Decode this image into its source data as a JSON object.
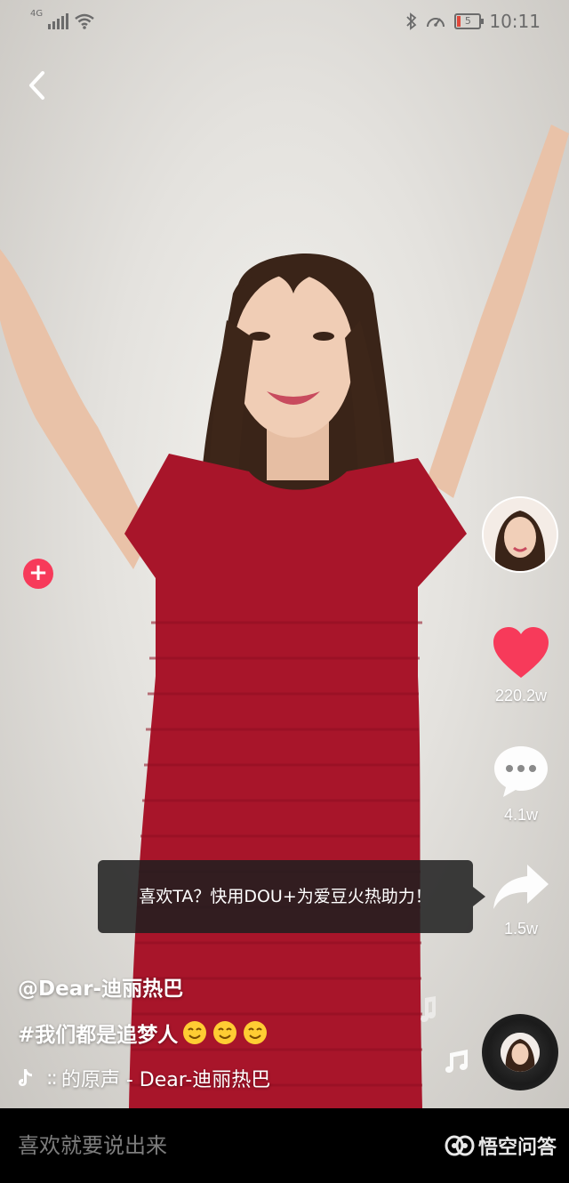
{
  "status_bar": {
    "network": "4G",
    "battery_level": "5",
    "time": "10:11"
  },
  "actions": {
    "likes": "220.2w",
    "comments": "4.1w",
    "shares": "1.5w"
  },
  "tooltip": {
    "text": "喜欢TA？快用DOU+为爱豆火热助力！"
  },
  "video_info": {
    "username": "@Dear-迪丽热巴",
    "hashtag": "#我们都是追梦人",
    "music_marquee_edge": "::",
    "music": "的原声 - Dear-迪丽热巴"
  },
  "comment_bar": {
    "placeholder": "喜欢就要说出来"
  },
  "watermark": {
    "text": "悟空问答"
  },
  "colors": {
    "like_red": "#f73a5a",
    "tooltip_bg": "#1e1e1e",
    "dress_red": "#a8152a",
    "comment_bar_bg": "#000000"
  },
  "icons": [
    "back-icon",
    "heart-icon",
    "comment-icon",
    "share-icon",
    "music-note-icon",
    "tiktok-logo-icon",
    "plus-icon",
    "wukong-logo-icon"
  ]
}
